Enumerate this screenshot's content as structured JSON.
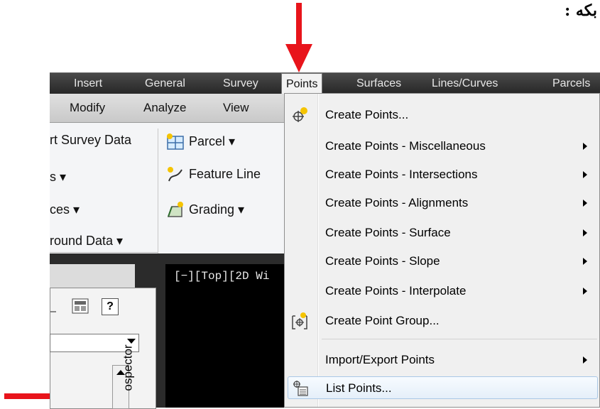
{
  "caption": "بكه :",
  "menubar": {
    "items": [
      "Insert",
      "General",
      "Survey",
      "Points",
      "Surfaces",
      "Lines/Curves",
      "Parcels"
    ],
    "active_index": 3
  },
  "tabbar": {
    "items": [
      "Modify",
      "Analyze",
      "View"
    ]
  },
  "ribbon": {
    "left_items": [
      "rt Survey Data",
      "s ▾",
      "ces ▾",
      "round Data ▾"
    ],
    "right_items": [
      "Parcel ▾",
      "Feature Line",
      "Grading ▾"
    ]
  },
  "palette": {
    "help_label": "?",
    "side_label": "ospector"
  },
  "viewport": {
    "label": "[−][Top][2D Wi"
  },
  "dropdown": {
    "items": [
      {
        "label": "Create Points...",
        "submenu": false,
        "icon": "create-points-icon"
      },
      {
        "label": "Create Points - Miscellaneous",
        "submenu": true
      },
      {
        "label": "Create Points - Intersections",
        "submenu": true
      },
      {
        "label": "Create Points - Alignments",
        "submenu": true
      },
      {
        "label": "Create Points - Surface",
        "submenu": true
      },
      {
        "label": "Create Points - Slope",
        "submenu": true
      },
      {
        "label": "Create Points - Interpolate",
        "submenu": true
      },
      {
        "label": "Create Point Group...",
        "submenu": false,
        "icon": "point-group-icon"
      },
      {
        "label": "Import/Export Points",
        "submenu": true
      },
      {
        "label": "List Points...",
        "submenu": false,
        "icon": "list-points-icon",
        "highlighted": true
      }
    ]
  },
  "colors": {
    "arrow": "#e8141b",
    "menubar": "#2e2e2e",
    "highlight": "#e5eff9"
  }
}
